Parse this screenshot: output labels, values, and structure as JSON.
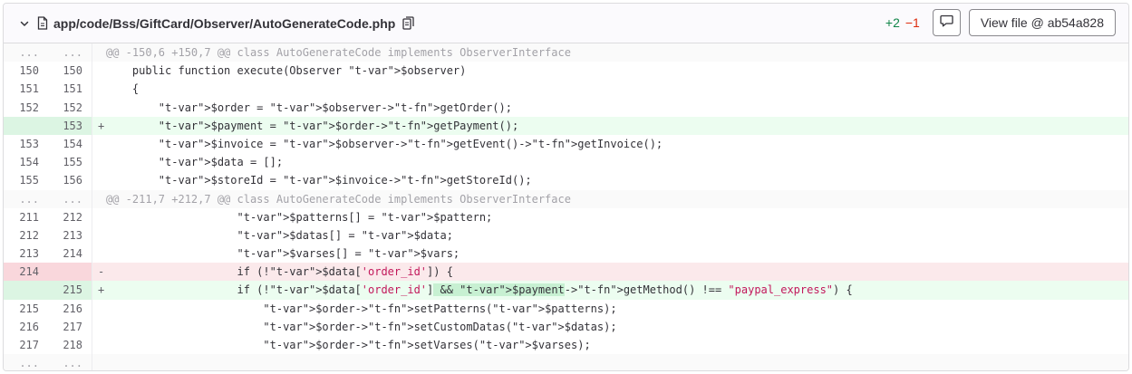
{
  "header": {
    "path": "app/code/Bss/GiftCard/Observer/AutoGenerateCode.php",
    "additions": "+2",
    "deletions": "−1",
    "view_file_label": "View file @ ab54a828"
  },
  "rows": [
    {
      "type": "match",
      "old": "...",
      "new": "...",
      "sign": "",
      "code": "@@ -150,6 +150,7 @@ class AutoGenerateCode implements ObserverInterface"
    },
    {
      "type": "context",
      "old": "150",
      "new": "150",
      "sign": "",
      "code": "    public function execute(Observer $observer)"
    },
    {
      "type": "context",
      "old": "151",
      "new": "151",
      "sign": "",
      "code": "    {"
    },
    {
      "type": "context",
      "old": "152",
      "new": "152",
      "sign": "",
      "code": "        $order = $observer->getOrder();"
    },
    {
      "type": "added",
      "old": "",
      "new": "153",
      "sign": "+",
      "code": "        $payment = $order->getPayment();"
    },
    {
      "type": "context",
      "old": "153",
      "new": "154",
      "sign": "",
      "code": "        $invoice = $observer->getEvent()->getInvoice();"
    },
    {
      "type": "context",
      "old": "154",
      "new": "155",
      "sign": "",
      "code": "        $data = [];"
    },
    {
      "type": "context",
      "old": "155",
      "new": "156",
      "sign": "",
      "code": "        $storeId = $invoice->getStoreId();"
    },
    {
      "type": "match",
      "old": "...",
      "new": "...",
      "sign": "",
      "code": "@@ -211,7 +212,7 @@ class AutoGenerateCode implements ObserverInterface"
    },
    {
      "type": "context",
      "old": "211",
      "new": "212",
      "sign": "",
      "code": "                    $patterns[] = $pattern;"
    },
    {
      "type": "context",
      "old": "212",
      "new": "213",
      "sign": "",
      "code": "                    $datas[] = $data;"
    },
    {
      "type": "context",
      "old": "213",
      "new": "214",
      "sign": "",
      "code": "                    $varses[] = $vars;"
    },
    {
      "type": "removed",
      "old": "214",
      "new": "",
      "sign": "-",
      "code": "                    if (!$data['order_id']) {"
    },
    {
      "type": "added",
      "old": "",
      "new": "215",
      "sign": "+",
      "code": "                    if (!$data['order_id'] && $payment->getMethod() !== \"paypal_express\") {"
    },
    {
      "type": "context",
      "old": "215",
      "new": "216",
      "sign": "",
      "code": "                        $order->setPatterns($patterns);"
    },
    {
      "type": "context",
      "old": "216",
      "new": "217",
      "sign": "",
      "code": "                        $order->setCustomDatas($datas);"
    },
    {
      "type": "context",
      "old": "217",
      "new": "218",
      "sign": "",
      "code": "                        $order->setVarses($varses);"
    },
    {
      "type": "match",
      "old": "...",
      "new": "...",
      "sign": "",
      "code": ""
    }
  ],
  "highlight": {
    "row_index": 13,
    "text": " && $payment->getMethod() !== \"paypal_express\""
  },
  "icons": {
    "chevron": "chevron-down-icon",
    "file": "file-icon",
    "copy": "copy-icon",
    "comment": "comment-icon"
  },
  "colors": {
    "added_bg": "#ecfdf0",
    "removed_bg": "#fbe9eb",
    "additions": "#108548",
    "deletions": "#dd2b0e"
  }
}
